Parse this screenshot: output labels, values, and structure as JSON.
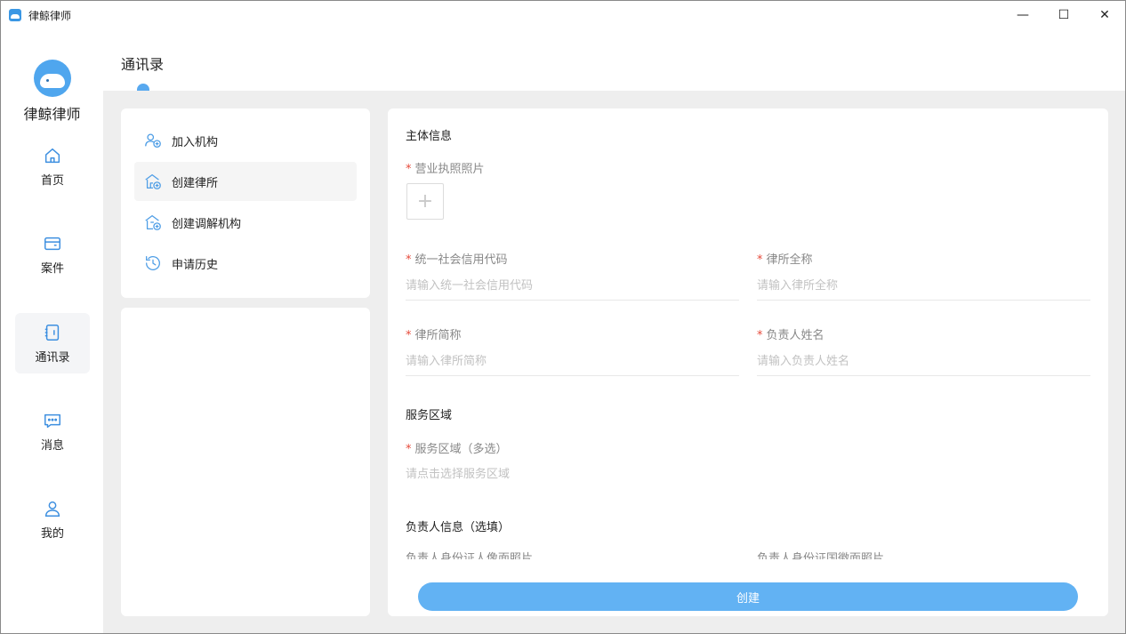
{
  "window": {
    "title": "律鲸律师",
    "controls": {
      "minimize": "—",
      "maximize": "☐",
      "close": "✕"
    }
  },
  "sidebar": {
    "brand": "律鲸律师",
    "items": [
      {
        "label": "首页",
        "icon": "home-icon"
      },
      {
        "label": "案件",
        "icon": "case-icon"
      },
      {
        "label": "通讯录",
        "icon": "contacts-icon",
        "active": true
      },
      {
        "label": "消息",
        "icon": "message-icon"
      },
      {
        "label": "我的",
        "icon": "user-icon"
      }
    ]
  },
  "page": {
    "title": "通讯录"
  },
  "menu": {
    "items": [
      {
        "label": "加入机构",
        "icon": "join-org-icon"
      },
      {
        "label": "创建律所",
        "icon": "create-firm-icon",
        "selected": true
      },
      {
        "label": "创建调解机构",
        "icon": "create-mediation-icon"
      },
      {
        "label": "申请历史",
        "icon": "history-icon"
      }
    ]
  },
  "form": {
    "section_main": "主体信息",
    "license_label": "营业执照照片",
    "upload_plus": "+",
    "credit_code": {
      "label": "统一社会信用代码",
      "placeholder": "请输入统一社会信用代码"
    },
    "firm_fullname": {
      "label": "律所全称",
      "placeholder": "请输入律所全称"
    },
    "firm_shortname": {
      "label": "律所简称",
      "placeholder": "请输入律所简称"
    },
    "manager_name": {
      "label": "负责人姓名",
      "placeholder": "请输入负责人姓名"
    },
    "section_area": "服务区域",
    "area": {
      "label": "服务区域（多选）",
      "hint": "请点击选择服务区域"
    },
    "section_manager": "负责人信息（选填）",
    "id_front_label": "负责人身份证人像面照片",
    "id_back_label": "负责人身份证国徽面照片",
    "submit": "创建",
    "required_mark": "*"
  },
  "colors": {
    "accent": "#62b2f3",
    "required": "#e64a3b",
    "background": "#eeeeee"
  }
}
